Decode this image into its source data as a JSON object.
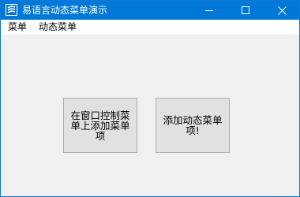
{
  "window": {
    "title": "易语言动态菜单演示",
    "colors": {
      "titlebar": "#0078d7",
      "client": "#f0f0f0",
      "button_face": "#e1e1e1"
    },
    "icons": {
      "app": "e-language-app-icon",
      "minimize": "minimize-icon",
      "maximize": "maximize-icon",
      "close": "close-icon"
    }
  },
  "menubar": {
    "items": [
      {
        "label": "菜单"
      },
      {
        "label": "动态菜单"
      }
    ]
  },
  "buttons": {
    "add_to_control_menu": "在窗口控制菜单上添加菜单项",
    "add_dynamic_menu": "添加动态菜单项!"
  }
}
